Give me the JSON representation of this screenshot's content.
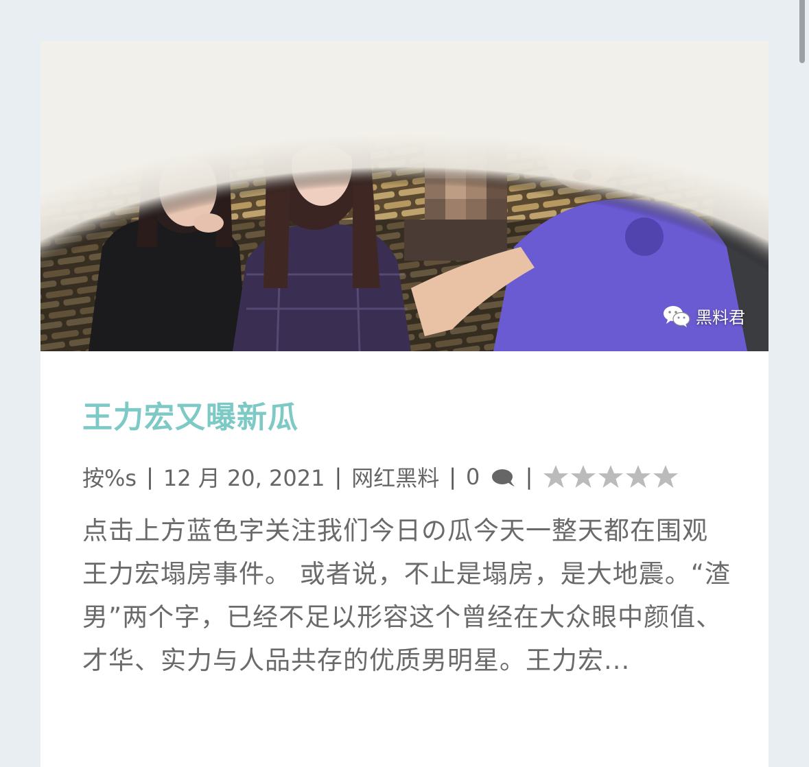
{
  "post": {
    "image_alt": "王力宏又曝新瓜 配图",
    "watermark": "黑料君",
    "title": "王力宏又曝新瓜",
    "meta": {
      "author_label": "按%s",
      "date": "12 月 20, 2021",
      "category": "网红黑料",
      "comments": "0",
      "rating": 0,
      "rating_max": 5
    },
    "excerpt": "点击上方蓝色字关注我们今日の瓜今天一整天都在围观王力宏塌房事件。 或者说，不止是塌房，是大地震。“渣男”两个字，已经不足以形容这个曾经在大众眼中颜值、才华、实力与人品共存的优质男明星。王力宏..."
  },
  "colors": {
    "title": "#7cc9c6",
    "meta": "#666666",
    "excerpt": "#6a6a6a",
    "background": "#e9eef2",
    "card": "#ffffff"
  }
}
